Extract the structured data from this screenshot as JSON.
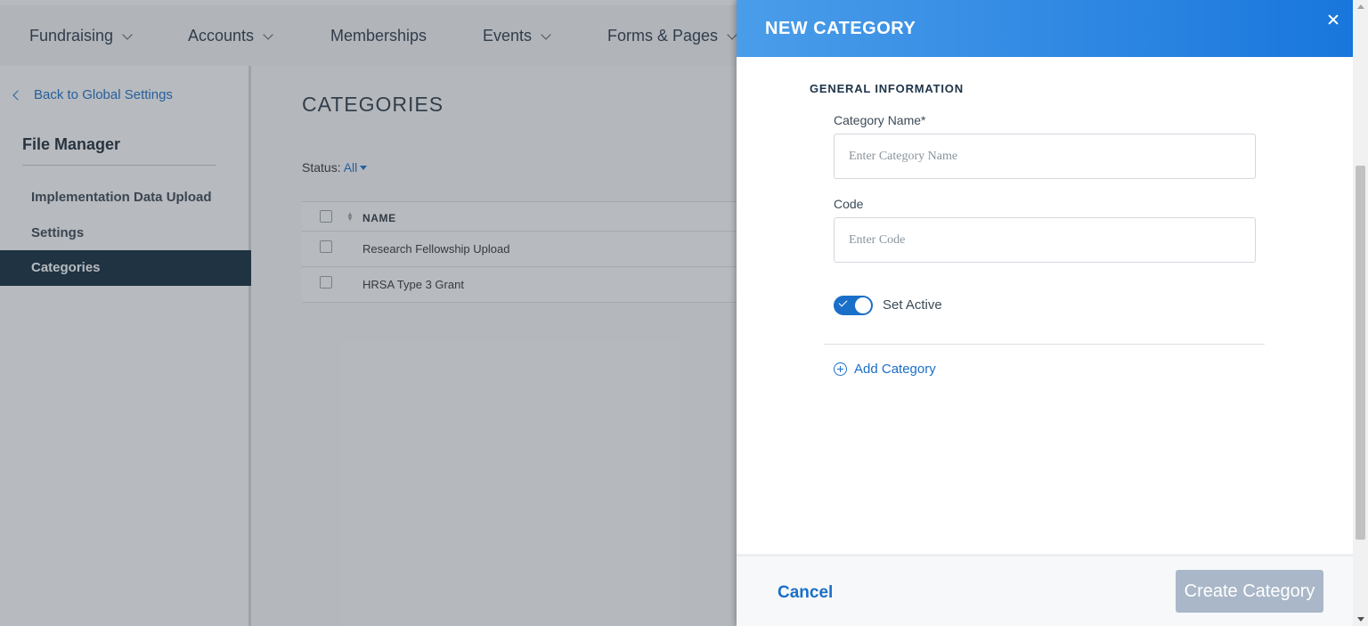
{
  "topnav": {
    "items": [
      {
        "label": "Fundraising",
        "has_dropdown": true
      },
      {
        "label": "Accounts",
        "has_dropdown": true
      },
      {
        "label": "Memberships",
        "has_dropdown": false
      },
      {
        "label": "Events",
        "has_dropdown": true
      },
      {
        "label": "Forms & Pages",
        "has_dropdown": true
      }
    ]
  },
  "sidebar": {
    "back_label": "Back to Global Settings",
    "title": "File Manager",
    "items": [
      {
        "label": "Implementation Data Upload",
        "active": false
      },
      {
        "label": "Settings",
        "active": false
      },
      {
        "label": "Categories",
        "active": true
      }
    ]
  },
  "main": {
    "title": "CATEGORIES",
    "status_label": "Status:",
    "status_value": "All",
    "table": {
      "header": "NAME",
      "rows": [
        "Research Fellowship Upload",
        "HRSA Type 3 Grant"
      ]
    }
  },
  "panel": {
    "title": "NEW CATEGORY",
    "section": "GENERAL INFORMATION",
    "name_label": "Category Name*",
    "name_placeholder": "Enter Category Name",
    "name_value": "",
    "code_label": "Code",
    "code_placeholder": "Enter Code",
    "code_value": "",
    "toggle_label": "Set Active",
    "toggle_on": true,
    "add_label": "Add Category",
    "cancel_label": "Cancel",
    "create_label": "Create Category"
  },
  "colors": {
    "accent": "#1a6fc9",
    "header_gradient_start": "#4a9de9",
    "header_gradient_end": "#1876dc",
    "sidebar_active": "#0f2a3d",
    "button_disabled": "#a9b7c8"
  },
  "icons": {
    "close": "close-icon",
    "back": "chevron-left-icon",
    "dropdown": "chevron-down-icon",
    "add": "plus-circle-icon",
    "toggle_check": "check-icon"
  }
}
